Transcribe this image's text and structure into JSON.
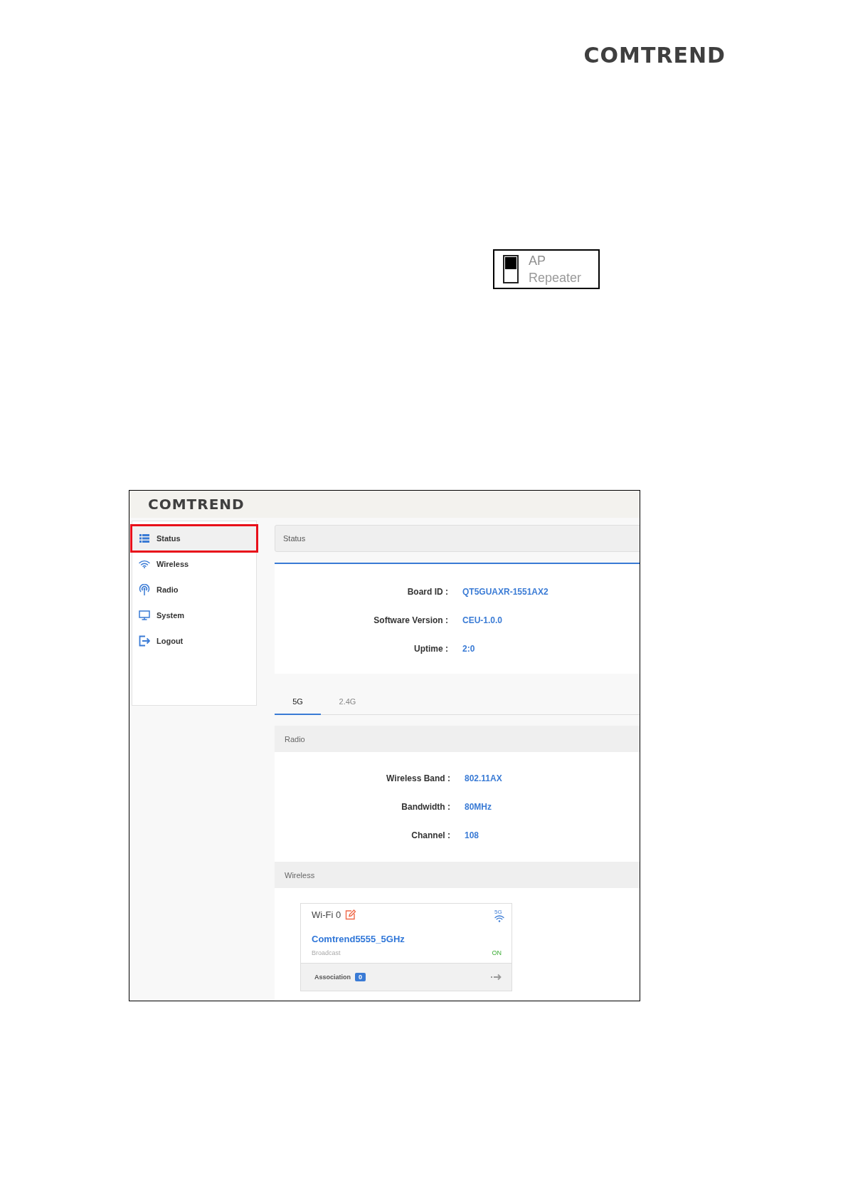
{
  "logo": "COMTREND",
  "mode_switch": {
    "options": [
      {
        "label": "AP",
        "selected": true
      },
      {
        "label": "Repeater",
        "selected": false
      }
    ]
  },
  "screenshot": {
    "logo": "COMTREND",
    "sidebar": {
      "items": [
        {
          "label": "Status",
          "selected": true,
          "highlighted": true
        },
        {
          "label": "Wireless",
          "selected": false,
          "highlighted": false
        },
        {
          "label": "Radio",
          "selected": false,
          "highlighted": false
        },
        {
          "label": "System",
          "selected": false,
          "highlighted": false
        },
        {
          "label": "Logout",
          "selected": false,
          "highlighted": false
        }
      ]
    },
    "status": {
      "title": "Status",
      "rows": [
        {
          "label": "Board ID :",
          "value": "QT5GUAXR-1551AX2"
        },
        {
          "label": "Software Version :",
          "value": "CEU-1.0.0"
        },
        {
          "label": "Uptime :",
          "value": "2:0"
        }
      ]
    },
    "tabs": [
      {
        "label": "5G",
        "selected": true
      },
      {
        "label": "2.4G",
        "selected": false
      }
    ],
    "radio": {
      "title": "Radio",
      "rows": [
        {
          "label": "Wireless Band :",
          "value": "802.11AX"
        },
        {
          "label": "Bandwidth :",
          "value": "80MHz"
        },
        {
          "label": "Channel :",
          "value": "108"
        }
      ]
    },
    "wireless": {
      "title": "Wireless",
      "card": {
        "title": "Wi-Fi 0",
        "band": "5G",
        "ssid": "Comtrend5555_5GHz",
        "broadcast_label": "Broadcast",
        "broadcast_state": "ON",
        "association_label": "Association",
        "association_count": "0"
      }
    }
  }
}
